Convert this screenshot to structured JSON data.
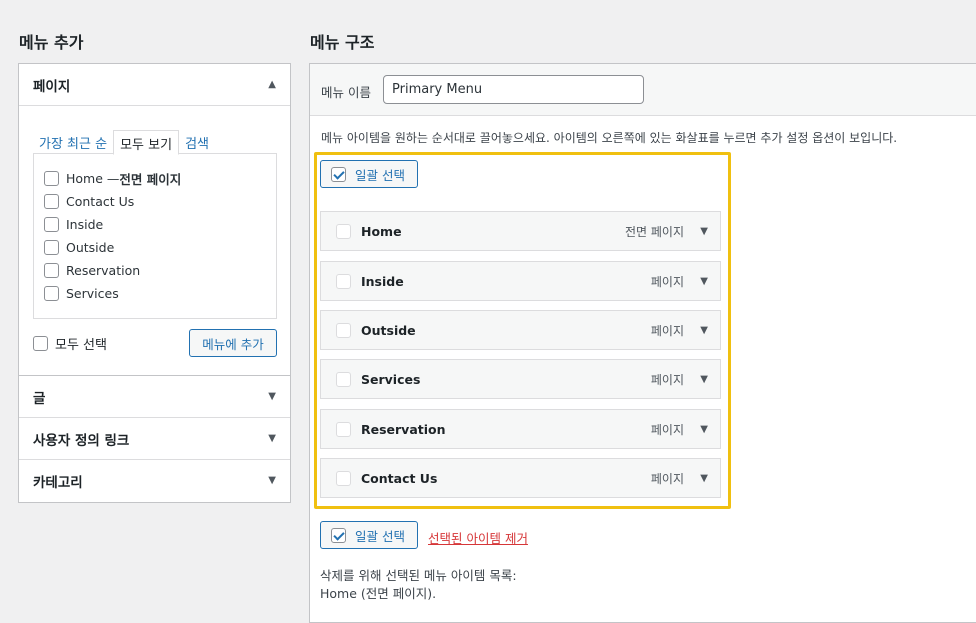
{
  "left_heading": "메뉴 추가",
  "right_heading": "메뉴 구조",
  "accordion": {
    "pages": {
      "title": "페이지",
      "tabs": [
        "가장 최근 순",
        "모두 보기",
        "검색"
      ],
      "active_tab": "모두 보기",
      "items": [
        {
          "label": "Home — ",
          "suffix": "전면 페이지"
        },
        {
          "label": "Contact Us",
          "suffix": ""
        },
        {
          "label": "Inside",
          "suffix": ""
        },
        {
          "label": "Outside",
          "suffix": ""
        },
        {
          "label": "Reservation",
          "suffix": ""
        },
        {
          "label": "Services",
          "suffix": ""
        }
      ],
      "select_all_label": "모두 선택",
      "add_button": "메뉴에 추가"
    },
    "sections": [
      "글",
      "사용자 정의 링크",
      "카테고리"
    ]
  },
  "menu": {
    "name_label": "메뉴 이름",
    "name_value": "Primary Menu",
    "instructions": "메뉴 아이템을 원하는 순서대로 끌어놓으세요. 아이템의 오른쪽에 있는 화살표를 누르면 추가 설정 옵션이 보입니다.",
    "bulk_select_label": "일괄 선택",
    "items": [
      {
        "title": "Home",
        "type": "전면 페이지"
      },
      {
        "title": "Inside",
        "type": "페이지"
      },
      {
        "title": "Outside",
        "type": "페이지"
      },
      {
        "title": "Services",
        "type": "페이지"
      },
      {
        "title": "Reservation",
        "type": "페이지"
      },
      {
        "title": "Contact Us",
        "type": "페이지"
      }
    ],
    "remove_selected": "선택된 아이템 제거",
    "deletion_label": "삭제를 위해 선택된 메뉴 아이템 목록:",
    "deletion_items": "Home (전면 페이지)."
  },
  "colors": {
    "accent": "#2271b1",
    "highlight": "#f0c010",
    "danger": "#d63638"
  }
}
